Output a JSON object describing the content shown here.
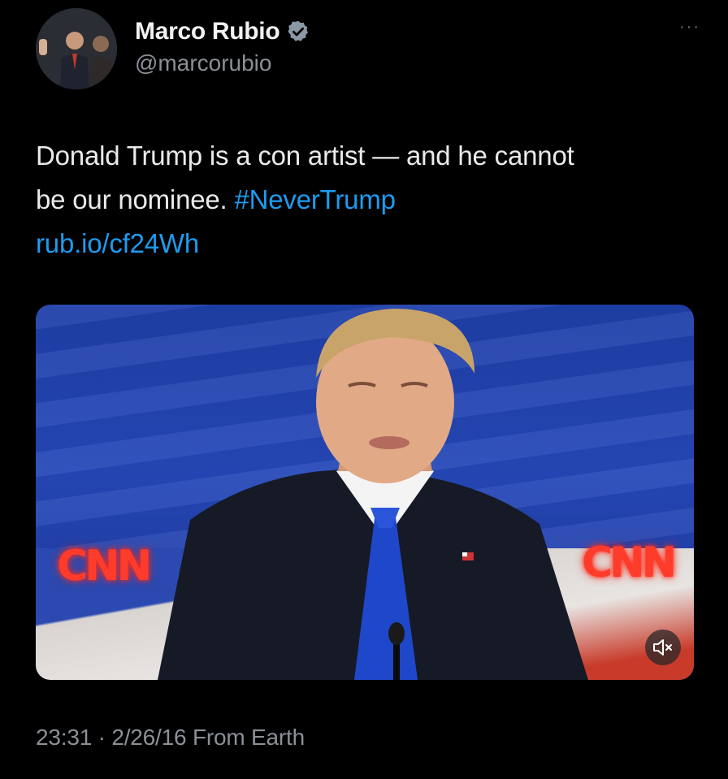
{
  "tweet": {
    "author": {
      "display_name": "Marco Rubio",
      "handle": "@marcorubio",
      "verified": true,
      "avatar_icon": "profile-photo"
    },
    "more_label": "···",
    "text_line_1": "Donald Trump is a con artist — and he cannot",
    "text_line_2_plain": "be our nominee.",
    "hashtag": "#NeverTrump",
    "link": "rub.io/cf24Wh",
    "media": {
      "type": "video",
      "logo_text_left": "CNN",
      "logo_text_right": "CNN",
      "mute_icon": "speaker-muted-icon"
    },
    "meta": "23:31 · 2/26/16 From Earth"
  },
  "colors": {
    "background": "#000000",
    "link": "#1d9bf0",
    "verified_badge": "#8b98a5",
    "secondary_text": "#8b9096"
  }
}
